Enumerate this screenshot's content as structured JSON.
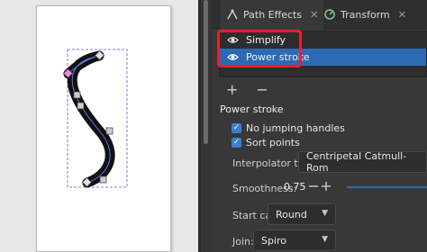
{
  "tabs": [
    {
      "label": "Path Effects",
      "close": "✕",
      "icon": "path-effects-icon"
    },
    {
      "label": "Transform",
      "close": "✕",
      "icon": "transform-icon"
    }
  ],
  "effects": [
    {
      "label": "Simplify",
      "selected": false,
      "icon": "eye-icon"
    },
    {
      "label": "Power stroke",
      "selected": true,
      "icon": "eye-icon"
    }
  ],
  "list_controls": {
    "add": "+",
    "remove": "−"
  },
  "section_title": "Power stroke",
  "options": {
    "no_jumping_handles": {
      "label": "No jumping handles",
      "checked": true
    },
    "sort_points": {
      "label": "Sort points",
      "checked": true
    }
  },
  "interpolator": {
    "label": "Interpolator type:",
    "value": "Centripetal Catmull-Rom"
  },
  "smoothness": {
    "label": "Smoothness:",
    "value": "0.75"
  },
  "start_cap": {
    "label": "Start cap:",
    "value": "Round"
  },
  "join": {
    "label": "Join:",
    "value": "Spiro"
  },
  "colors": {
    "accent": "#2d6ab6",
    "highlight": "#e8202c",
    "panel": "#383838"
  }
}
